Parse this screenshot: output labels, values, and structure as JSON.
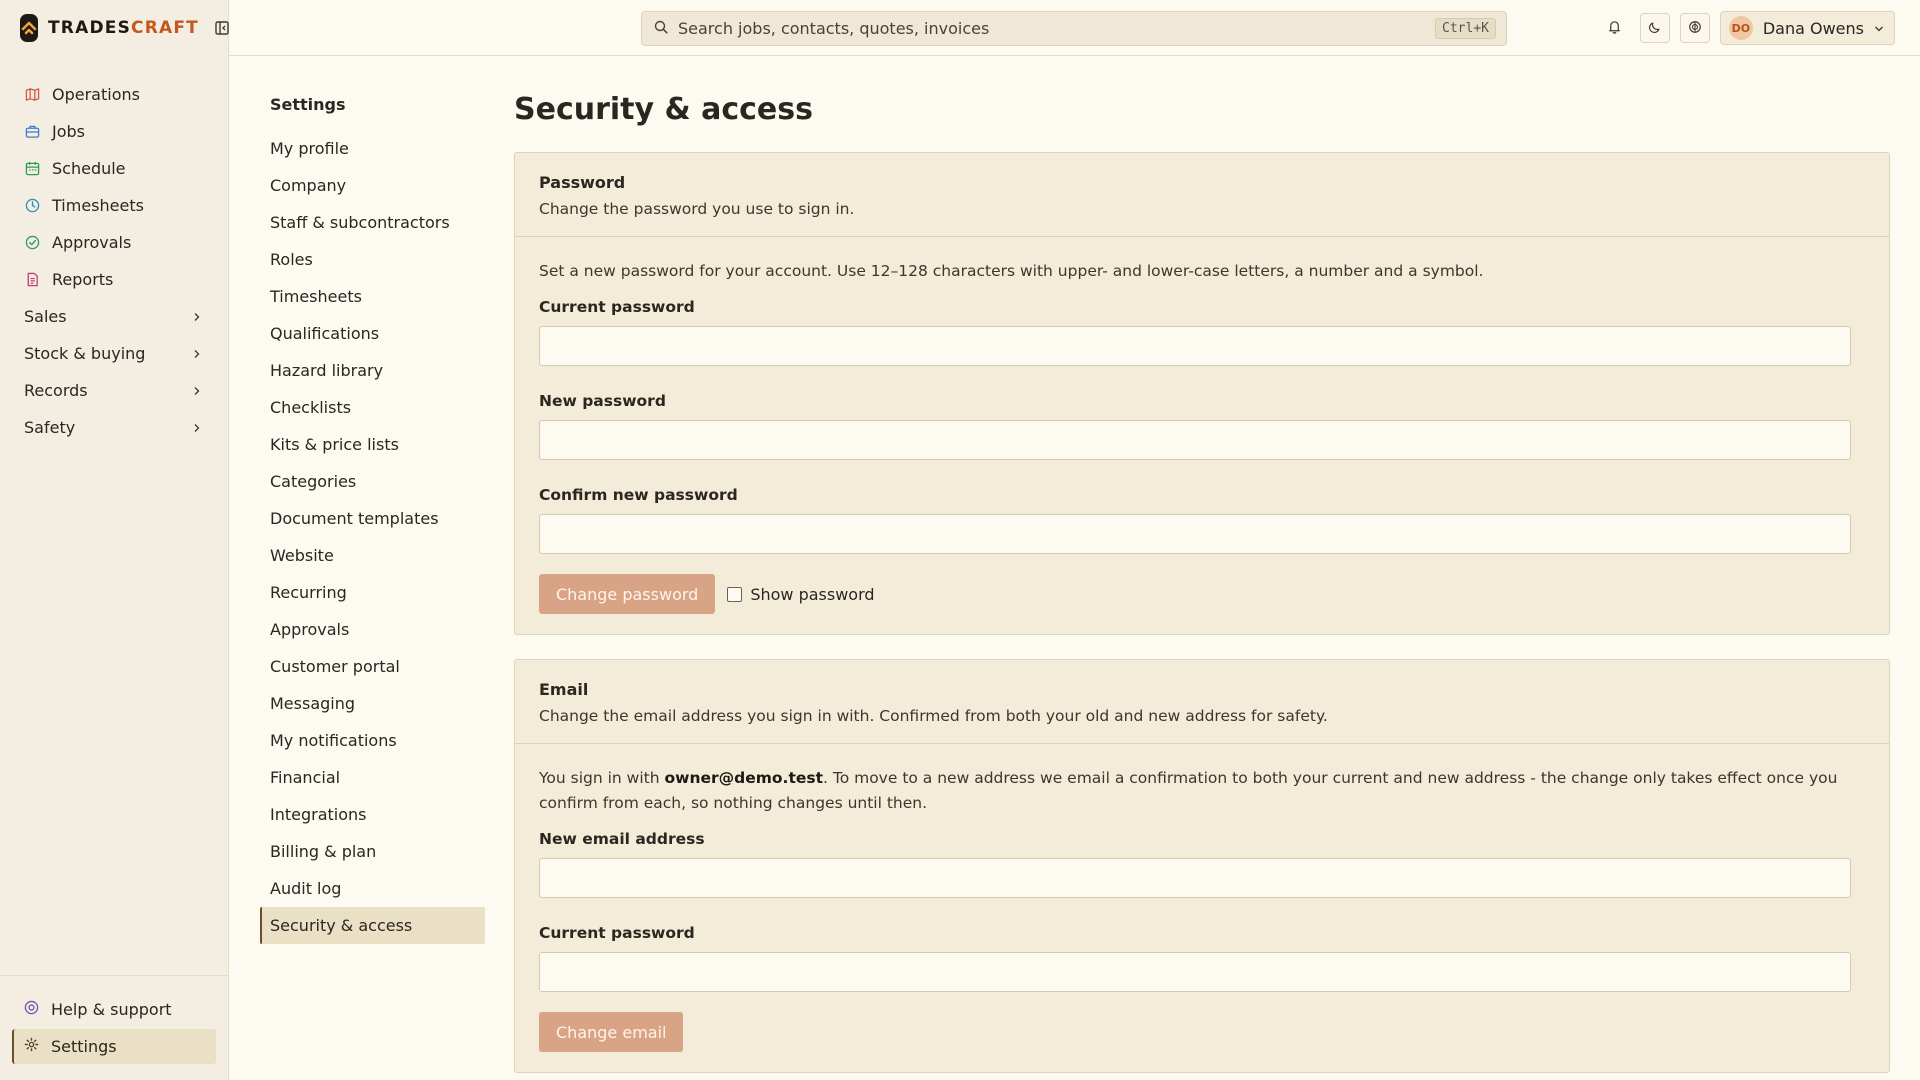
{
  "brand": {
    "name_part1": "TRADES",
    "name_part2": "CRAFT"
  },
  "colors": {
    "accent": "#c4571d",
    "button": "#d9a385",
    "sidebar_bg": "#f3eee1",
    "page_bg": "#fdfaf2",
    "card_bg": "#f3ecd9"
  },
  "sidebar": {
    "items": [
      {
        "label": "Operations",
        "icon": "map-icon",
        "color": "#d9534f"
      },
      {
        "label": "Jobs",
        "icon": "briefcase-icon",
        "color": "#3b7bd6"
      },
      {
        "label": "Schedule",
        "icon": "calendar-icon",
        "color": "#2f9b59"
      },
      {
        "label": "Timesheets",
        "icon": "clock-icon",
        "color": "#2f8fb5"
      },
      {
        "label": "Approvals",
        "icon": "check-circle-icon",
        "color": "#2f9b59"
      },
      {
        "label": "Reports",
        "icon": "document-icon",
        "color": "#c2407a"
      }
    ],
    "groups": [
      {
        "label": "Sales"
      },
      {
        "label": "Stock & buying"
      },
      {
        "label": "Records"
      },
      {
        "label": "Safety"
      }
    ],
    "footer": [
      {
        "label": "Help & support",
        "icon": "help-icon"
      },
      {
        "label": "Settings",
        "icon": "gear-icon"
      }
    ]
  },
  "topbar": {
    "search_placeholder": "Search jobs, contacts, quotes, invoices",
    "search_shortcut": "Ctrl+K",
    "user": {
      "initials": "DO",
      "name": "Dana Owens"
    }
  },
  "settings_nav": {
    "title": "Settings",
    "items": [
      "My profile",
      "Company",
      "Staff & subcontractors",
      "Roles",
      "Timesheets",
      "Qualifications",
      "Hazard library",
      "Checklists",
      "Kits & price lists",
      "Categories",
      "Document templates",
      "Website",
      "Recurring",
      "Approvals",
      "Customer portal",
      "Messaging",
      "My notifications",
      "Financial",
      "Integrations",
      "Billing & plan",
      "Audit log",
      "Security & access"
    ],
    "active": "Security & access"
  },
  "page": {
    "title": "Security & access",
    "password_card": {
      "title": "Password",
      "subtitle": "Change the password you use to sign in.",
      "intro": "Set a new password for your account. Use 12–128 characters with upper- and lower-case letters, a number and a symbol.",
      "current_label": "Current password",
      "new_label": "New password",
      "confirm_label": "Confirm new password",
      "submit_label": "Change password",
      "show_label": "Show password"
    },
    "email_card": {
      "title": "Email",
      "subtitle": "Change the email address you sign in with. Confirmed from both your old and new address for safety.",
      "intro_prefix": "You sign in with ",
      "current_email": "owner@demo.test",
      "intro_suffix": ". To move to a new address we email a confirmation to both your current and new address - the change only takes effect once you confirm from each, so nothing changes until then.",
      "new_email_label": "New email address",
      "current_password_label": "Current password",
      "submit_label": "Change email"
    }
  }
}
